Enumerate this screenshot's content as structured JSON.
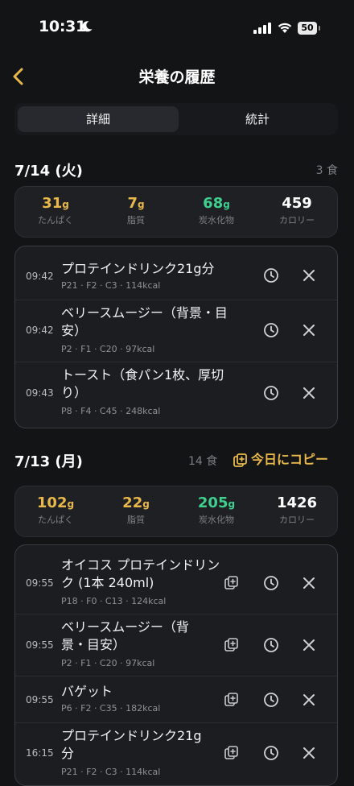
{
  "status": {
    "time": "10:31",
    "battery": "50"
  },
  "nav": {
    "title": "栄養の履歴"
  },
  "tabs": [
    {
      "label": "詳細"
    },
    {
      "label": "統計"
    }
  ],
  "days": [
    {
      "date": "7/14 (火)",
      "count": "3 食",
      "summary": {
        "protein": "31",
        "fat": "7",
        "carbs": "68",
        "calories": "459",
        "unit": "g",
        "labels": {
          "protein": "たんぱく",
          "fat": "脂質",
          "carbs": "炭水化物",
          "calories": "カロリー"
        }
      },
      "entries": [
        {
          "time": "09:42",
          "name": "プロテインドリンク21g分",
          "macros": "P21 · F2 · C3 · 114kcal"
        },
        {
          "time": "09:42",
          "name": "ベリースムージー（背景・目安）",
          "macros": "P2 · F1 · C20 · 97kcal"
        },
        {
          "time": "09:43",
          "name": "トースト（食パン1枚、厚切り）",
          "macros": "P8 · F4 · C45 · 248kcal"
        }
      ]
    },
    {
      "date": "7/13 (月)",
      "count": "14 食",
      "copy_label": "今日にコピー",
      "summary": {
        "protein": "102",
        "fat": "22",
        "carbs": "205",
        "calories": "1426",
        "unit": "g",
        "labels": {
          "protein": "たんぱく",
          "fat": "脂質",
          "carbs": "炭水化物",
          "calories": "カロリー"
        }
      },
      "entries": [
        {
          "time": "09:55",
          "name": "オイコス プロテインドリンク (1本 240ml)",
          "macros": "P18 · F0 · C13 · 124kcal"
        },
        {
          "time": "09:55",
          "name": "ベリースムージー（背景・目安）",
          "macros": "P2 · F1 · C20 · 97kcal"
        },
        {
          "time": "09:55",
          "name": "バゲット",
          "macros": "P6 · F2 · C35 · 182kcal"
        },
        {
          "time": "16:15",
          "name": "プロテインドリンク21g分",
          "macros": "P21 · F2 · C3 · 114kcal"
        }
      ]
    }
  ],
  "colors": {
    "accent": "#e8b84a",
    "carbs": "#3fcf8e",
    "background": "#131416"
  },
  "icons": {
    "back": "chevron-left-icon",
    "clock": "clock-icon",
    "delete": "close-icon",
    "copy": "copy-plus-icon"
  }
}
